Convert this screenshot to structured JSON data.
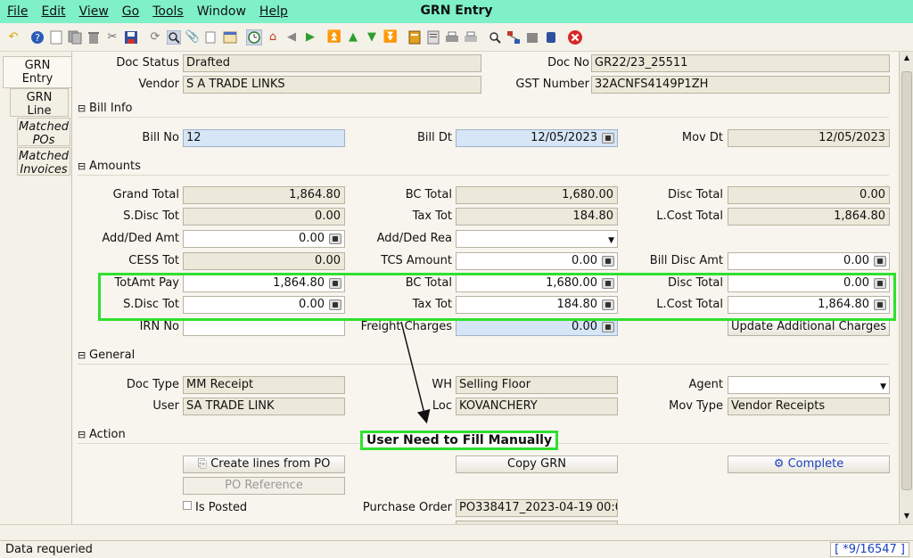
{
  "menubar": {
    "items": [
      {
        "label": "File",
        "mnemonic_index": 0
      },
      {
        "label": "Edit",
        "mnemonic_index": 0
      },
      {
        "label": "View",
        "mnemonic_index": 0
      },
      {
        "label": "Go",
        "mnemonic_index": 0
      },
      {
        "label": "Tools",
        "mnemonic_index": 0
      },
      {
        "label": "Window",
        "mnemonic_index": -1
      },
      {
        "label": "Help",
        "mnemonic_index": 0
      }
    ],
    "title": "GRN Entry",
    "background": "#7ff0c8"
  },
  "toolbar": {
    "icons": [
      "undo-icon",
      "help-icon",
      "new-icon",
      "copy-icon",
      "delete-icon",
      "delete-selection-icon",
      "save-icon",
      "refresh-icon",
      "find-icon",
      "attachment-icon",
      "chat-icon",
      "history-icon",
      "report-icon",
      "home-icon",
      "back-icon",
      "forward-icon",
      "first-record-icon",
      "previous-record-icon",
      "next-record-icon",
      "last-record-icon",
      "archive-icon",
      "request-icon",
      "print-icon",
      "print-preview-icon",
      "zoom-icon",
      "workflow-icon",
      "process-icon",
      "product-info-icon",
      "close-icon"
    ]
  },
  "tabs": [
    {
      "label_line1": "GRN",
      "label_line2": "Entry",
      "active": true
    },
    {
      "label_line1": "GRN",
      "label_line2": "Line",
      "active": false
    },
    {
      "label_line1": "Matched",
      "label_line2": "POs",
      "active": false
    },
    {
      "label_line1": "Matched",
      "label_line2": "Invoices",
      "active": false
    }
  ],
  "header": {
    "doc_status_label": "Doc Status",
    "doc_status_value": "Drafted",
    "doc_no_label": "Doc No",
    "doc_no_value": "GR22/23_25511",
    "vendor_label": "Vendor",
    "vendor_value": "S A TRADE LINKS",
    "gst_label": "GST Number",
    "gst_value": "32ACNFS4149P1ZH"
  },
  "bill_info": {
    "section_label": "Bill Info",
    "bill_no_label": "Bill No",
    "bill_no_value": "12",
    "bill_dt_label": "Bill Dt",
    "bill_dt_value": "12/05/2023",
    "mov_dt_label": "Mov Dt",
    "mov_dt_value": "12/05/2023"
  },
  "amounts": {
    "section_label": "Amounts",
    "grand_total_label": "Grand Total",
    "grand_total_value": "1,864.80",
    "bc_total_label": "BC Total",
    "bc_total_value": "1,680.00",
    "disc_total_label": "Disc Total",
    "disc_total_value": "0.00",
    "sdisc_tot_label": "S.Disc Tot",
    "sdisc_tot_value": "0.00",
    "tax_tot_label": "Tax Tot",
    "tax_tot_value": "184.80",
    "lcost_total_label": "L.Cost Total",
    "lcost_total_value": "1,864.80",
    "add_ded_amt_label": "Add/Ded Amt",
    "add_ded_amt_value": "0.00",
    "add_ded_rea_label": "Add/Ded Rea",
    "add_ded_rea_value": "",
    "cess_tot_label": "CESS Tot",
    "cess_tot_value": "0.00",
    "tcs_amount_label": "TCS Amount",
    "tcs_amount_value": "0.00",
    "bill_disc_amt_label": "Bill Disc Amt",
    "bill_disc_amt_value": "0.00",
    "totamt_pay_label": "TotAmt Pay",
    "totamt_pay_value": "1,864.80",
    "bc_total2_label": "BC Total",
    "bc_total2_value": "1,680.00",
    "disc_total2_label": "Disc Total",
    "disc_total2_value": "0.00",
    "sdisc_tot2_label": "S.Disc Tot",
    "sdisc_tot2_value": "0.00",
    "tax_tot2_label": "Tax Tot",
    "tax_tot2_value": "184.80",
    "lcost_total2_label": "L.Cost Total",
    "lcost_total2_value": "1,864.80",
    "irn_no_label": "IRN No",
    "irn_no_value": "",
    "freight_label": "Freight Charges",
    "freight_value": "0.00",
    "update_btn_label": "Update Additional Charges"
  },
  "general": {
    "section_label": "General",
    "doc_type_label": "Doc Type",
    "doc_type_value": "MM Receipt",
    "wh_label": "WH",
    "wh_value": "Selling Floor",
    "agent_label": "Agent",
    "agent_value": "",
    "user_label": "User",
    "user_value": "SA TRADE LINK",
    "loc_label": "Loc",
    "loc_value": "KOVANCHERY",
    "mov_type_label": "Mov Type",
    "mov_type_value": "Vendor Receipts"
  },
  "action": {
    "section_label": "Action",
    "create_lines_label": "Create lines from PO",
    "copy_grn_label": "Copy GRN",
    "complete_label": "Complete",
    "po_reference_label": "PO Reference",
    "is_posted_label": "Is Posted",
    "purchase_order_label": "Purchase Order",
    "purchase_order_value": "PO338417_2023-04-19 00:0"
  },
  "annotation": {
    "text": "User Need to Fill Manually",
    "color": "#2fe02f"
  },
  "statusbar": {
    "message": "Data requeried",
    "record_info": "[ *9/16547 ]"
  }
}
